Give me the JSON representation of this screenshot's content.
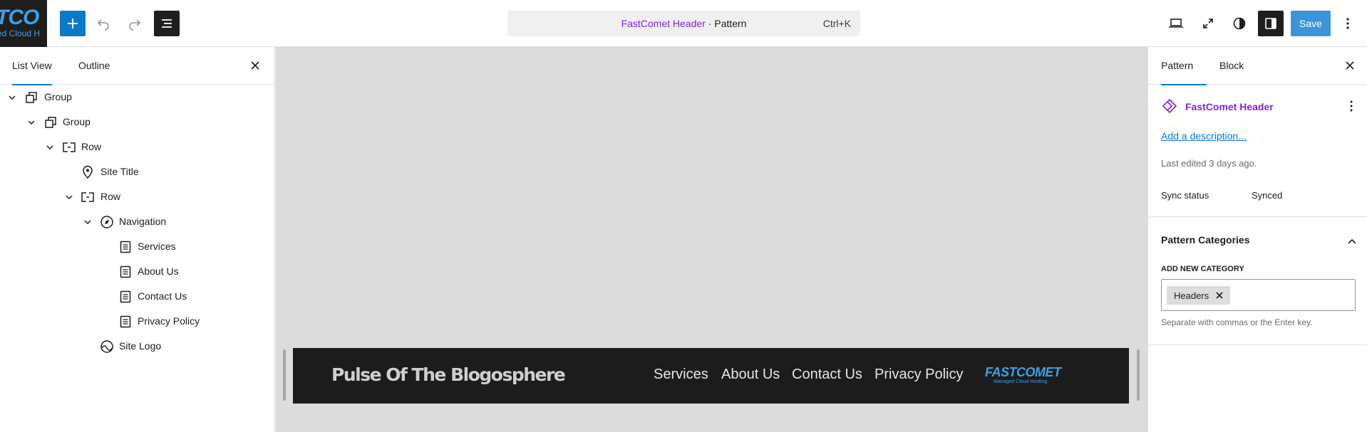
{
  "site_logo": {
    "line1": "TCO",
    "line2": "ed Cloud H"
  },
  "toolbar": {
    "command_pattern_name": "FastComet Header",
    "command_suffix": " · Pattern",
    "command_shortcut": "Ctrl+K",
    "save_label": "Save"
  },
  "left_panel": {
    "tabs": [
      {
        "label": "List View",
        "active": true
      },
      {
        "label": "Outline",
        "active": false
      }
    ],
    "tree": [
      {
        "label": "Group",
        "icon": "group-icon",
        "expanded": true
      },
      {
        "label": "Group",
        "icon": "group-icon",
        "expanded": true
      },
      {
        "label": "Row",
        "icon": "row-icon",
        "expanded": true
      },
      {
        "label": "Site Title",
        "icon": "map-pin-icon"
      },
      {
        "label": "Row",
        "icon": "row-icon",
        "expanded": true
      },
      {
        "label": "Navigation",
        "icon": "compass-icon",
        "expanded": true
      },
      {
        "label": "Services",
        "icon": "page-icon"
      },
      {
        "label": "About Us",
        "icon": "page-icon"
      },
      {
        "label": "Contact Us",
        "icon": "page-icon"
      },
      {
        "label": "Privacy Policy",
        "icon": "page-icon"
      },
      {
        "label": "Site Logo",
        "icon": "site-logo-icon"
      }
    ]
  },
  "canvas": {
    "header_preview": {
      "site_title": "Pulse Of The Blogosphere",
      "nav": [
        "Services",
        "About Us",
        "Contact Us",
        "Privacy Policy"
      ],
      "logo_text": "FASTCOMET",
      "logo_tagline": "Managed Cloud Hosting"
    }
  },
  "right_panel": {
    "tabs": [
      {
        "label": "Pattern",
        "active": true
      },
      {
        "label": "Block",
        "active": false
      }
    ],
    "pattern_name": "FastComet Header",
    "add_description": "Add a description...",
    "last_edited": "Last edited 3 days ago.",
    "sync_status_label": "Sync status",
    "sync_status_value": "Synced",
    "categories_title": "Pattern Categories",
    "add_category_label": "ADD NEW CATEGORY",
    "category_tokens": [
      "Headers"
    ],
    "category_help": "Separate with commas or the Enter key."
  },
  "colors": {
    "accent": "#0b7ac8",
    "pattern": "#8224e3",
    "save": "#3b95d8"
  }
}
